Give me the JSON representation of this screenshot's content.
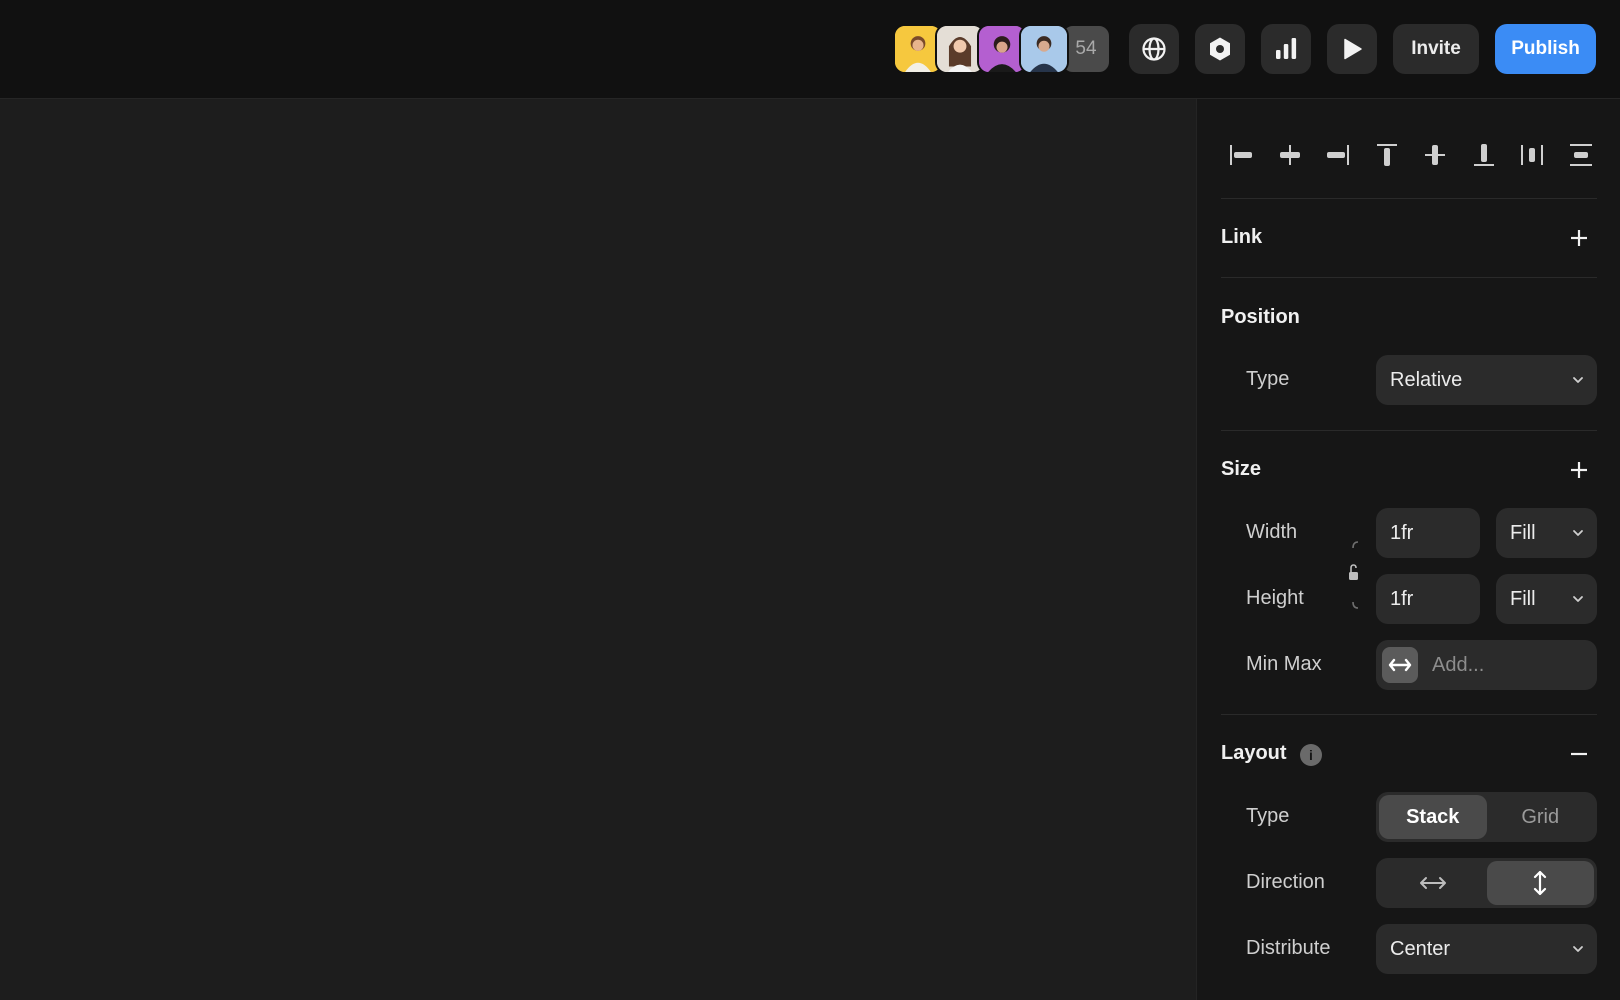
{
  "toolbar": {
    "collaborators": [
      {
        "name": "collaborator-1",
        "bg": "#f6c83e"
      },
      {
        "name": "collaborator-2",
        "bg": "#dcd6cf"
      },
      {
        "name": "collaborator-3",
        "bg": "#a855c9"
      },
      {
        "name": "collaborator-4",
        "bg": "#9cc2e6"
      }
    ],
    "collaborator_count": "54",
    "icons": [
      "globe-icon",
      "settings-hexagon-icon",
      "analytics-icon",
      "play-icon"
    ],
    "invite_label": "Invite",
    "publish_label": "Publish",
    "publish_color": "#3b8cf5"
  },
  "panel": {
    "align_icons": [
      "align-left-icon",
      "align-center-horizontal-icon",
      "align-right-icon",
      "align-top-icon",
      "align-center-vertical-icon",
      "align-bottom-icon",
      "distribute-horizontal-icon",
      "distribute-vertical-icon"
    ],
    "link": {
      "title": "Link"
    },
    "position": {
      "title": "Position",
      "type_label": "Type",
      "type_value": "Relative"
    },
    "size": {
      "title": "Size",
      "width_label": "Width",
      "width_value": "1fr",
      "width_mode": "Fill",
      "height_label": "Height",
      "height_value": "1fr",
      "height_mode": "Fill",
      "minmax_label": "Min Max",
      "minmax_placeholder": "Add..."
    },
    "layout": {
      "title": "Layout",
      "info": "i",
      "type_label": "Type",
      "type_options": [
        "Stack",
        "Grid"
      ],
      "type_selected": "Stack",
      "direction_label": "Direction",
      "direction_selected": "vertical",
      "distribute_label": "Distribute",
      "distribute_value": "Center"
    }
  }
}
